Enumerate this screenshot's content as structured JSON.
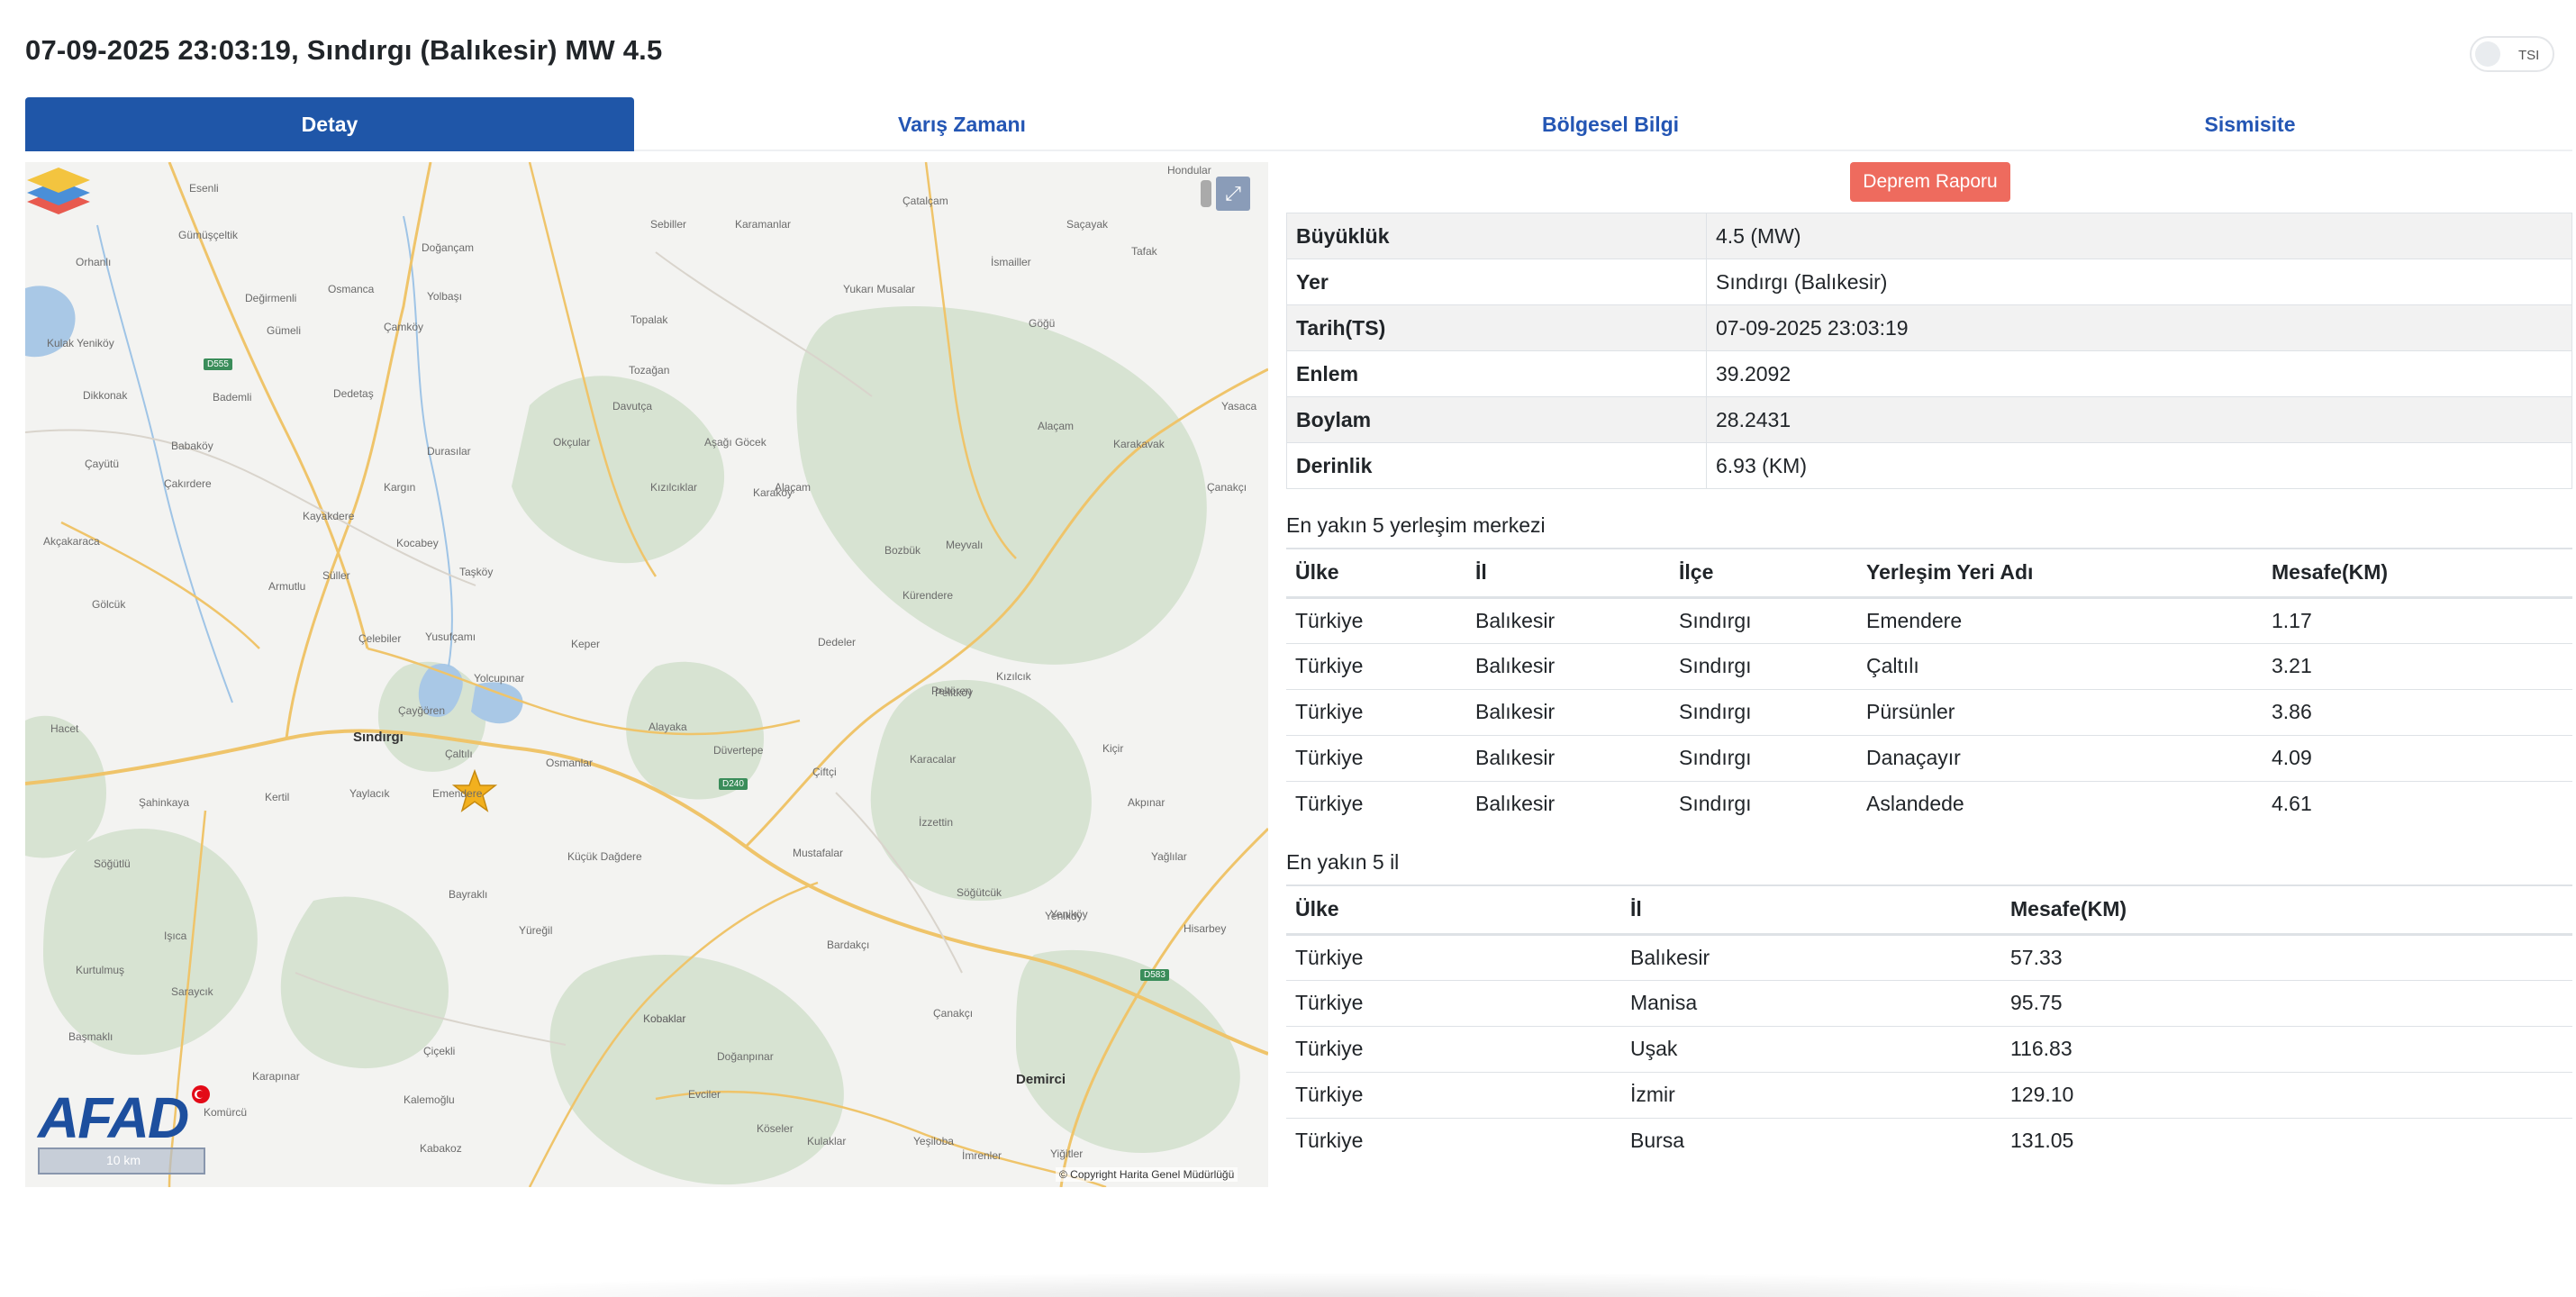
{
  "header": {
    "title": "07-09-2025 23:03:19, Sındırgı (Balıkesir) MW 4.5",
    "tsi_label": "TSI"
  },
  "tabs": [
    {
      "label": "Detay",
      "active": true
    },
    {
      "label": "Varış Zamanı",
      "active": false
    },
    {
      "label": "Bölgesel Bilgi",
      "active": false
    },
    {
      "label": "Sismisite",
      "active": false
    }
  ],
  "map": {
    "fullscreen_icon": "expand-icon",
    "logo_text": "AFAD",
    "scale_label": "10 km",
    "copyright": "© Copyright Harita Genel Müdürlüğü",
    "towns": [
      {
        "name": "Sındırgı",
        "major": true
      },
      {
        "name": "Demirci",
        "major": true
      },
      {
        "name": "Emendere"
      },
      {
        "name": "Çaltılı"
      },
      {
        "name": "Çayğören"
      },
      {
        "name": "Yusufçamı"
      },
      {
        "name": "Yolcupınar"
      },
      {
        "name": "Osmanlar"
      },
      {
        "name": "Alayaka"
      },
      {
        "name": "Düvertepe"
      },
      {
        "name": "Keper"
      },
      {
        "name": "Kocabey"
      },
      {
        "name": "Dedeler"
      },
      {
        "name": "Şahinkaya"
      },
      {
        "name": "Yaylacık"
      },
      {
        "name": "Kertil"
      },
      {
        "name": "Bayraklı"
      },
      {
        "name": "Küçük Dağdere"
      },
      {
        "name": "Yüreğil"
      },
      {
        "name": "Kobaklar"
      },
      {
        "name": "Çanakçı"
      },
      {
        "name": "Karacalar"
      },
      {
        "name": "İzzettin"
      },
      {
        "name": "Çiftçi"
      },
      {
        "name": "Mustafalar"
      },
      {
        "name": "Bardakçı"
      },
      {
        "name": "Söğütcük"
      },
      {
        "name": "Akpınar"
      },
      {
        "name": "Yağlılar"
      },
      {
        "name": "Hacet"
      },
      {
        "name": "Çelebiler"
      },
      {
        "name": "Taşköy"
      },
      {
        "name": "Armutlu"
      },
      {
        "name": "Söğütlü"
      },
      {
        "name": "Kargın"
      },
      {
        "name": "Durasılar"
      },
      {
        "name": "Okçular"
      },
      {
        "name": "Davutça"
      },
      {
        "name": "Topalak"
      },
      {
        "name": "Yolbaşı"
      },
      {
        "name": "Doğançam"
      },
      {
        "name": "Osmanca"
      },
      {
        "name": "Gümeli"
      },
      {
        "name": "Esenli"
      },
      {
        "name": "Sebiller"
      },
      {
        "name": "Karamanlar"
      },
      {
        "name": "Çatalçam"
      },
      {
        "name": "Saçayak"
      },
      {
        "name": "Tafak"
      },
      {
        "name": "Hondular"
      },
      {
        "name": "Yasaca"
      },
      {
        "name": "Çanakçı"
      },
      {
        "name": "Alaçam"
      },
      {
        "name": "Meyvalı"
      },
      {
        "name": "Bozbük"
      },
      {
        "name": "Kürendere"
      },
      {
        "name": "Peltören"
      },
      {
        "name": "Kızılcık"
      },
      {
        "name": "Kiçir"
      },
      {
        "name": "Yenikdy"
      },
      {
        "name": "Hisarbey"
      },
      {
        "name": "Kobaklar"
      },
      {
        "name": "Doğanpınar"
      },
      {
        "name": "Evciler"
      },
      {
        "name": "Köseler"
      },
      {
        "name": "Kulaklar"
      },
      {
        "name": "Yeşiloba"
      },
      {
        "name": "Yiğitler"
      },
      {
        "name": "İmrenler"
      },
      {
        "name": "Kalemoğlu"
      },
      {
        "name": "Komürcü"
      },
      {
        "name": "Kabakoz"
      },
      {
        "name": "Çiçekli"
      },
      {
        "name": "Karapınar"
      },
      {
        "name": "Saraycık"
      },
      {
        "name": "Başmaklı"
      },
      {
        "name": "Kurtulmuş"
      },
      {
        "name": "Işıca"
      },
      {
        "name": "Yeniköy"
      },
      {
        "name": "Pelitköy"
      },
      {
        "name": "Gölcük"
      },
      {
        "name": "Dikkonak"
      },
      {
        "name": "Çayütü"
      },
      {
        "name": "Akçakaraca"
      },
      {
        "name": "Kulak Yeniköy"
      },
      {
        "name": "Orhanlı"
      },
      {
        "name": "Gümüşçeltik"
      },
      {
        "name": "Değirmenli"
      },
      {
        "name": "Çamköy"
      },
      {
        "name": "Dedetaş"
      },
      {
        "name": "Bademli"
      },
      {
        "name": "Babaköy"
      },
      {
        "name": "Çakırdere"
      },
      {
        "name": "Kayakdere"
      },
      {
        "name": "Süller"
      },
      {
        "name": "Alaçam"
      },
      {
        "name": "Aşağı Göcek"
      },
      {
        "name": "Karaköy"
      },
      {
        "name": "Kızılcıklar"
      },
      {
        "name": "Tozağan"
      },
      {
        "name": "Yukarı Musalar"
      },
      {
        "name": "İsmailler"
      },
      {
        "name": "Karakavak"
      },
      {
        "name": "Göğü"
      }
    ],
    "roads": [
      "D555",
      "D240",
      "D583"
    ]
  },
  "report_button": "Deprem Raporu",
  "details": [
    {
      "key": "Büyüklük",
      "value": "4.5 (MW)"
    },
    {
      "key": "Yer",
      "value": "Sındırgı (Balıkesir)"
    },
    {
      "key": "Tarih(TS)",
      "value": "07-09-2025 23:03:19"
    },
    {
      "key": "Enlem",
      "value": "39.2092"
    },
    {
      "key": "Boylam",
      "value": "28.2431"
    },
    {
      "key": "Derinlik",
      "value": "6.93 (KM)"
    }
  ],
  "settlements": {
    "heading": "En yakın 5 yerleşim merkezi",
    "columns": [
      "Ülke",
      "İl",
      "İlçe",
      "Yerleşim Yeri Adı",
      "Mesafe(KM)"
    ],
    "rows": [
      [
        "Türkiye",
        "Balıkesir",
        "Sındırgı",
        "Emendere",
        "1.17"
      ],
      [
        "Türkiye",
        "Balıkesir",
        "Sındırgı",
        "Çaltılı",
        "3.21"
      ],
      [
        "Türkiye",
        "Balıkesir",
        "Sındırgı",
        "Pürsünler",
        "3.86"
      ],
      [
        "Türkiye",
        "Balıkesir",
        "Sındırgı",
        "Danaçayır",
        "4.09"
      ],
      [
        "Türkiye",
        "Balıkesir",
        "Sındırgı",
        "Aslandede",
        "4.61"
      ]
    ]
  },
  "provinces": {
    "heading": "En yakın 5 il",
    "columns": [
      "Ülke",
      "İl",
      "Mesafe(KM)"
    ],
    "rows": [
      [
        "Türkiye",
        "Balıkesir",
        "57.33"
      ],
      [
        "Türkiye",
        "Manisa",
        "95.75"
      ],
      [
        "Türkiye",
        "Uşak",
        "116.83"
      ],
      [
        "Türkiye",
        "İzmir",
        "129.10"
      ],
      [
        "Türkiye",
        "Bursa",
        "131.05"
      ]
    ]
  }
}
